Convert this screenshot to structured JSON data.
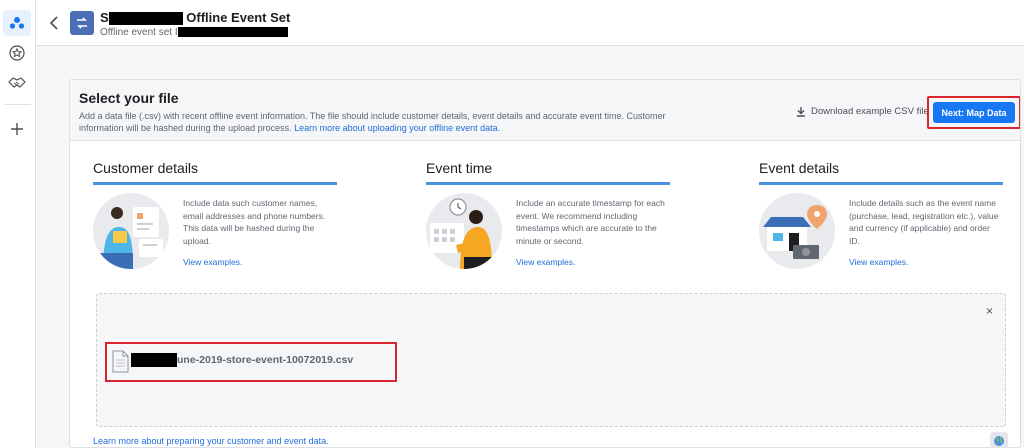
{
  "header": {
    "title_prefix": "S",
    "title_suffix": " Offline Event Set",
    "subtitle": "Offline event set I"
  },
  "select_file": {
    "title": "Select your file",
    "description": "Add a data file (.csv) with recent offline event information. The file should include customer details, event details and accurate event time. Customer information will be hashed during the upload process. ",
    "learn_more": "Learn more about uploading your offline event data.",
    "download_link": "Download example CSV file",
    "next_button": "Next: Map Data"
  },
  "columns": [
    {
      "title": "Customer details",
      "description": "Include data such customer names, email addresses and phone numbers. This data will be hashed during the upload.",
      "link": "View examples."
    },
    {
      "title": "Event time",
      "description": "Include an accurate timestamp for each event. We recommend including timestamps which are accurate to the minute or second.",
      "link": "View examples."
    },
    {
      "title": "Event details",
      "description": "Include details such as the event name (purchase, lead, registration etc.), value and currency (if applicable) and order ID.",
      "link": "View examples."
    }
  ],
  "upload": {
    "file_name": "une-2019-store-event-10072019.csv",
    "close": "×"
  },
  "footer_link": "Learn more about preparing your customer and event data.",
  "icons": [
    "audiences-icon",
    "star-icon",
    "handshake-icon",
    "plus-icon",
    "back-chevron-icon",
    "event-set-icon",
    "download-icon",
    "file-icon",
    "globe-icon"
  ],
  "colors": {
    "primary": "#1877f2",
    "highlight": "#d9262e",
    "accent_underline": "#4a90e2"
  }
}
